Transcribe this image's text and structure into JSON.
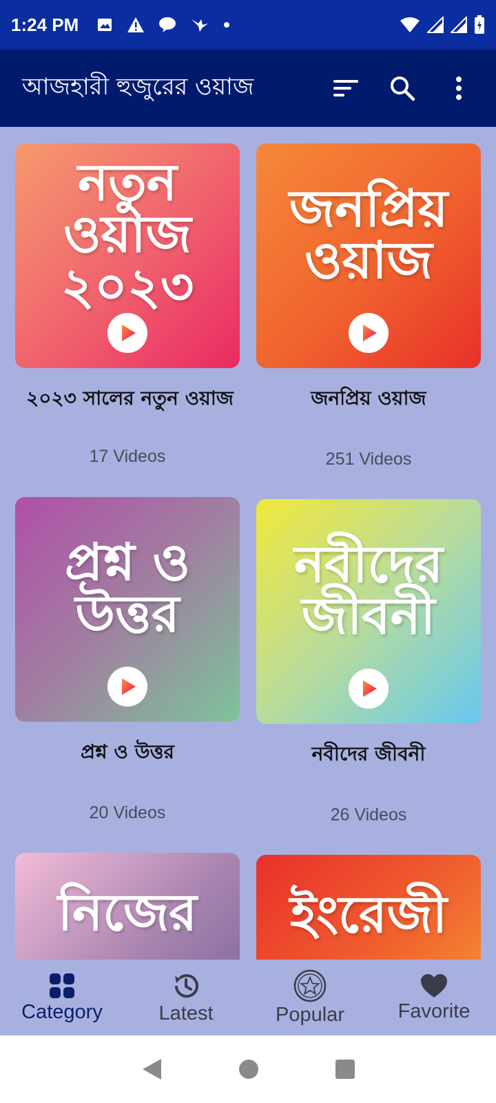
{
  "status_bar": {
    "time": "1:24 PM",
    "left_icons": [
      "image-icon",
      "warning-icon",
      "chat-bubble-icon",
      "bird-icon",
      "dot-icon"
    ],
    "right_icons": [
      "wifi-icon",
      "signal-icon",
      "signal-icon",
      "battery-icon"
    ]
  },
  "app_bar": {
    "title": "আজহারী হুজুরের ওয়াজ",
    "actions": [
      "sort-icon",
      "search-icon",
      "more-vert-icon"
    ]
  },
  "categories": [
    {
      "thumb_text": "নতুন\nওয়াজ\n২০২৩",
      "title": "২০২৩ সালের নতুন ওয়াজ",
      "count": "17 Videos"
    },
    {
      "thumb_text": "জনপ্রিয়\nওয়াজ",
      "title": "জনপ্রিয় ওয়াজ",
      "count": "251 Videos"
    },
    {
      "thumb_text": "প্রশ্ন ও\nউত্তর",
      "title": "প্রশ্ন ও উত্তর",
      "count": "20 Videos"
    },
    {
      "thumb_text": "নবীদের\nজীবনী",
      "title": "নবীদের জীবনী",
      "count": "26 Videos"
    },
    {
      "thumb_text": "নিজের",
      "title": "",
      "count": ""
    },
    {
      "thumb_text": "ইংরেজী",
      "title": "",
      "count": ""
    }
  ],
  "bottom_nav": {
    "items": [
      {
        "label": "Category",
        "icon": "category-grid-icon",
        "active": true
      },
      {
        "label": "Latest",
        "icon": "history-icon",
        "active": false
      },
      {
        "label": "Popular",
        "icon": "star-badge-icon",
        "active": false
      },
      {
        "label": "Favorite",
        "icon": "heart-icon",
        "active": false
      }
    ]
  },
  "colors": {
    "status_bar": "#0a2ea0",
    "app_bar": "#001a6e",
    "background": "#a8b0e0",
    "nav_active": "#0a1f6b"
  }
}
